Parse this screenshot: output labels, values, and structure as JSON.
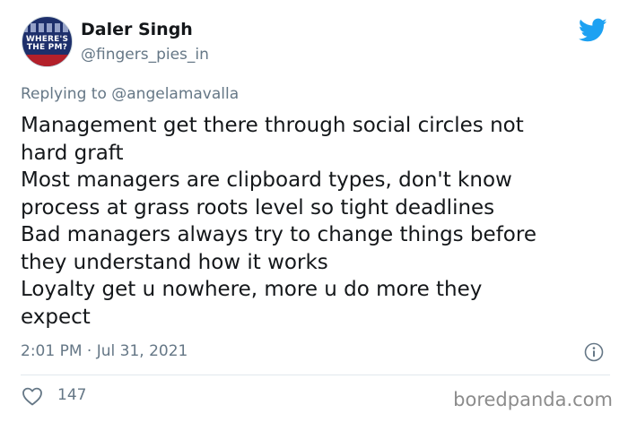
{
  "author": {
    "name": "Daler Singh",
    "handle": "@fingers_pies_in",
    "avatar_text_line1": "WHERE'S",
    "avatar_text_line2": "THE PM?"
  },
  "reply": {
    "prefix": "Replying to ",
    "mention": "@angelamavalla"
  },
  "body": {
    "lines": [
      "Management get there through social circles not",
      "hard graft",
      "Most managers are clipboard types, don't know",
      "process at grass roots level so tight deadlines",
      "Bad managers always try to change things before",
      "they understand how it works",
      "Loyalty get u nowhere, more u do more they",
      "expect"
    ]
  },
  "meta": {
    "timestamp": "2:01 PM · Jul 31, 2021"
  },
  "engagement": {
    "likes": "147"
  },
  "watermark": "boredpanda.com",
  "colors": {
    "twitter_blue": "#1DA1F2",
    "secondary_text": "#657786",
    "primary_text": "#14171A"
  },
  "icons": {
    "brand": "twitter-bird-icon",
    "info": "info-icon",
    "like": "heart-icon"
  }
}
